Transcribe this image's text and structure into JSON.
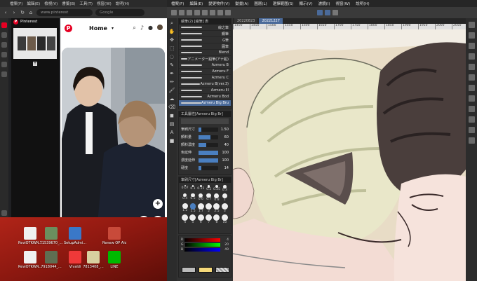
{
  "browser": {
    "menu": [
      "檔案(F)",
      "編輯(E)",
      "檢視(V)",
      "書籤(B)",
      "工具(T)",
      "視窗(W)",
      "說明(H)"
    ],
    "url": "www.pinterest",
    "search_placeholder": "Google",
    "side_panel": {
      "title": "Pinterest"
    },
    "pinterest": {
      "home_label": "Home",
      "plus": "+",
      "question": "?"
    }
  },
  "desktop": {
    "icons": [
      {
        "label": "ReviOTKWN...",
        "color": "#f0f0f0"
      },
      {
        "label": "71539670_...",
        "color": "#6b8f5e"
      },
      {
        "label": "SetupAdmi...",
        "color": "#3a78c8"
      },
      {
        "label": "Renew OP Aide",
        "color": "#c84a3a"
      },
      {
        "label": "ReviOTKWN...",
        "color": "#f0f0f0"
      },
      {
        "label": "7918044_...",
        "color": "#5f6e52"
      },
      {
        "label": "Vivaldi",
        "color": "#ef3939"
      },
      {
        "label": "7813408_...",
        "color": "#d8d0a0"
      },
      {
        "label": "LINE",
        "color": "#00b900"
      }
    ]
  },
  "csp": {
    "menu": [
      "檔案(F)",
      "編輯(E)",
      "變更物件(V)",
      "動畫(A)",
      "圖層(L)",
      "選擇範圍(S)",
      "顯示(V)",
      "濾鏡(I)",
      "視窗(W)",
      "說明(H)"
    ],
    "tool_icons": [
      "zoom-icon",
      "hand-icon",
      "move-icon",
      "selection-icon",
      "lasso-icon",
      "eyedropper-icon",
      "pen-icon",
      "pencil-icon",
      "brush-icon",
      "airbrush-icon",
      "eraser-icon",
      "fill-icon",
      "gradient-icon",
      "text-icon",
      "color-icon"
    ],
    "subtool_tabs": [
      "繪筆(2) [繪筆] 表",
      "筆"
    ],
    "subtool_items": [
      {
        "label": "線之筆",
        "sel": false
      },
      {
        "label": "鋼筆",
        "sel": false
      },
      {
        "label": "G筆",
        "sel": false
      },
      {
        "label": "圓筆",
        "sel": false
      },
      {
        "label": "Blend",
        "sel": false
      },
      {
        "label": "アニメーター鉛筆(アナ鉛)",
        "sel": false
      },
      {
        "label": "Azmeru B",
        "sel": false
      },
      {
        "label": "Azmeru F",
        "sel": false
      },
      {
        "label": "Azmeru C",
        "sel": false
      },
      {
        "label": "Azmeru B(ver.3)",
        "sel": false
      },
      {
        "label": "Azmeru III",
        "sel": false
      },
      {
        "label": "Azmeru Bod",
        "sel": false
      },
      {
        "label": "Azmeru Big Bru",
        "sel": true
      }
    ],
    "tool_property": {
      "title": "工具屬性[Azmeru Big Br]",
      "rows": [
        {
          "label": "筆刷尺寸",
          "value": "1.50",
          "fill": 0.15
        },
        {
          "label": "顏料量",
          "value": "60",
          "fill": 0.6
        },
        {
          "label": "顏料濃度",
          "value": "40",
          "fill": 0.4
        },
        {
          "label": "色延伸",
          "value": "100",
          "fill": 1.0
        },
        {
          "label": "濃度延伸",
          "value": "100",
          "fill": 1.0
        },
        {
          "label": "硬度",
          "value": "14",
          "fill": 0.14
        }
      ]
    },
    "brush_size": {
      "title": "筆刷尺寸[Azmeru Big Br]",
      "sizes": [
        "0.07",
        "0.1",
        "0.15",
        "0.2",
        "0.25",
        "0.3",
        "0.4",
        "0.5",
        "0.6",
        "0.7",
        "0.8",
        "1",
        "1.2",
        "1.5",
        "1.7",
        "2",
        "2.5",
        "3",
        "4",
        "5",
        "6",
        "7",
        "8",
        "10"
      ]
    },
    "color": {
      "sliders": [
        {
          "label": "R",
          "value": "4"
        },
        {
          "label": "G",
          "value": "20"
        },
        {
          "label": "B",
          "value": "49"
        }
      ],
      "main_color": "#3a2a2a",
      "sub_color": "#f5d97a"
    },
    "canvas_tabs": [
      {
        "label": "20220823",
        "active": false
      },
      {
        "label": "20221227",
        "active": true
      }
    ],
    "ruler": [
      "1400",
      "1450",
      "1500",
      "1550",
      "1600",
      "1650",
      "1700",
      "1750",
      "1800",
      "1850",
      "1900",
      "1950",
      "2000",
      "2050"
    ]
  }
}
